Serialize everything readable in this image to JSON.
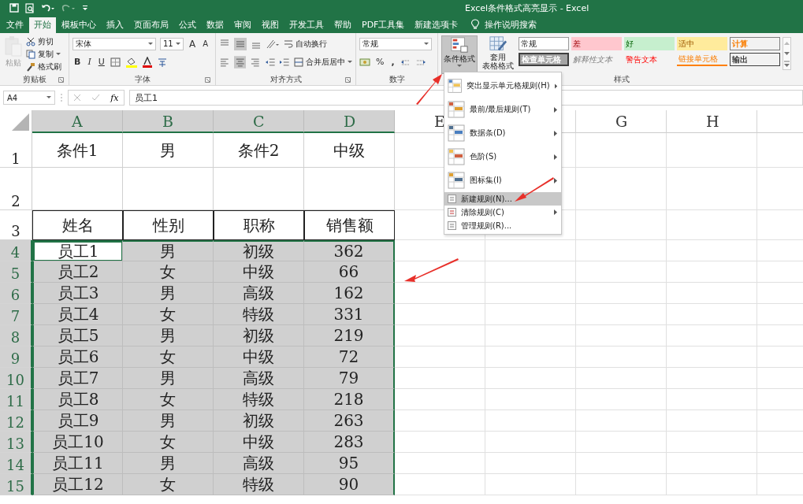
{
  "title_bar": {
    "title": "Excel条件格式高亮显示  -  Excel"
  },
  "tabs": [
    {
      "label": "文件",
      "selected": false
    },
    {
      "label": "开始",
      "selected": true
    },
    {
      "label": "模板中心",
      "selected": false
    },
    {
      "label": "插入",
      "selected": false
    },
    {
      "label": "页面布局",
      "selected": false
    },
    {
      "label": "公式",
      "selected": false
    },
    {
      "label": "数据",
      "selected": false
    },
    {
      "label": "审阅",
      "selected": false
    },
    {
      "label": "视图",
      "selected": false
    },
    {
      "label": "开发工具",
      "selected": false
    },
    {
      "label": "帮助",
      "selected": false
    },
    {
      "label": "PDF工具集",
      "selected": false
    },
    {
      "label": "新建选项卡",
      "selected": false
    }
  ],
  "tell_me": "操作说明搜索",
  "clipboard": {
    "paste": {
      "label": "粘贴",
      "disabled": true
    },
    "items": [
      {
        "label": "剪切",
        "caret": false
      },
      {
        "label": "复制",
        "caret": true
      },
      {
        "label": "格式刷",
        "caret": false
      }
    ],
    "group_label": "剪贴板"
  },
  "font": {
    "name": "宋体",
    "size": "11",
    "grow": "A",
    "shrink": "A",
    "bold": "B",
    "italic": "I",
    "underline": "U",
    "group_label": "字体"
  },
  "alignment": {
    "wrap": "自动换行",
    "merge": "合并后居中",
    "group_label": "对齐方式"
  },
  "number": {
    "format": "常规",
    "percent": "%",
    "comma": ",",
    "group_label": "数字"
  },
  "styles": {
    "conditional": {
      "label": "条件格式",
      "selected": true
    },
    "table_lines": [
      "套用",
      "表格格式"
    ],
    "cells": [
      {
        "label": "常规",
        "kind": "normal"
      },
      {
        "label": "差",
        "kind": "bad"
      },
      {
        "label": "好",
        "kind": "good"
      },
      {
        "label": "适中",
        "kind": "neutral"
      },
      {
        "label": "计算",
        "kind": "calculation"
      },
      {
        "label": "检查单元格",
        "kind": "check"
      },
      {
        "label": "解释性文本",
        "kind": "explanatory"
      },
      {
        "label": "警告文本",
        "kind": "warning"
      },
      {
        "label": "链接单元格",
        "kind": "linked"
      },
      {
        "label": "输出",
        "kind": "output"
      }
    ],
    "group_label": "样式"
  },
  "formula_bar": {
    "name_box": "A4",
    "fx": "fx",
    "value": "员工1"
  },
  "sheet": {
    "columns": [
      {
        "label": "A",
        "selected": true
      },
      {
        "label": "B",
        "selected": true
      },
      {
        "label": "C",
        "selected": true
      },
      {
        "label": "D",
        "selected": true
      },
      {
        "label": "E",
        "selected": false
      },
      {
        "selected": false
      },
      {
        "label": "G",
        "selected": false
      },
      {
        "label": "H",
        "selected": false
      }
    ],
    "rows": [
      {
        "number": "1",
        "kind": "plain",
        "selected": false,
        "cells": [
          {
            "text": "条件1",
            "active": false
          },
          {
            "text": "男",
            "active": false
          },
          {
            "text": "条件2",
            "active": false
          },
          {
            "text": "中级",
            "active": false
          }
        ]
      },
      {
        "number": "2",
        "kind": "plain",
        "selected": false,
        "cells": []
      },
      {
        "number": "3",
        "kind": "header",
        "selected": false,
        "cells": [
          {
            "text": "姓名",
            "active": false
          },
          {
            "text": "性别",
            "active": false
          },
          {
            "text": "职称",
            "active": false
          },
          {
            "text": "销售额",
            "active": false
          }
        ]
      },
      {
        "number": "4",
        "kind": "plain",
        "selected": true,
        "cells": [
          {
            "text": "员工1",
            "active": true
          },
          {
            "text": "男",
            "active": false
          },
          {
            "text": "初级",
            "active": false
          },
          {
            "text": "362",
            "active": false
          }
        ]
      },
      {
        "number": "5",
        "kind": "plain",
        "selected": true,
        "cells": [
          {
            "text": "员工2",
            "active": false
          },
          {
            "text": "女",
            "active": false
          },
          {
            "text": "中级",
            "active": false
          },
          {
            "text": "66",
            "active": false
          }
        ]
      },
      {
        "number": "6",
        "kind": "plain",
        "selected": true,
        "cells": [
          {
            "text": "员工3",
            "active": false
          },
          {
            "text": "男",
            "active": false
          },
          {
            "text": "高级",
            "active": false
          },
          {
            "text": "162",
            "active": false
          }
        ]
      },
      {
        "number": "7",
        "kind": "plain",
        "selected": true,
        "cells": [
          {
            "text": "员工4",
            "active": false
          },
          {
            "text": "女",
            "active": false
          },
          {
            "text": "特级",
            "active": false
          },
          {
            "text": "331",
            "active": false
          }
        ]
      },
      {
        "number": "8",
        "kind": "plain",
        "selected": true,
        "cells": [
          {
            "text": "员工5",
            "active": false
          },
          {
            "text": "男",
            "active": false
          },
          {
            "text": "初级",
            "active": false
          },
          {
            "text": "219",
            "active": false
          }
        ]
      },
      {
        "number": "9",
        "kind": "plain",
        "selected": true,
        "cells": [
          {
            "text": "员工6",
            "active": false
          },
          {
            "text": "女",
            "active": false
          },
          {
            "text": "中级",
            "active": false
          },
          {
            "text": "72",
            "active": false
          }
        ]
      },
      {
        "number": "10",
        "kind": "plain",
        "selected": true,
        "cells": [
          {
            "text": "员工7",
            "active": false
          },
          {
            "text": "男",
            "active": false
          },
          {
            "text": "高级",
            "active": false
          },
          {
            "text": "79",
            "active": false
          }
        ]
      },
      {
        "number": "11",
        "kind": "plain",
        "selected": true,
        "cells": [
          {
            "text": "员工8",
            "active": false
          },
          {
            "text": "女",
            "active": false
          },
          {
            "text": "特级",
            "active": false
          },
          {
            "text": "218",
            "active": false
          }
        ]
      },
      {
        "number": "12",
        "kind": "plain",
        "selected": true,
        "cells": [
          {
            "text": "员工9",
            "active": false
          },
          {
            "text": "男",
            "active": false
          },
          {
            "text": "初级",
            "active": false
          },
          {
            "text": "263",
            "active": false
          }
        ]
      },
      {
        "number": "13",
        "kind": "plain",
        "selected": true,
        "cells": [
          {
            "text": "员工10",
            "active": false
          },
          {
            "text": "女",
            "active": false
          },
          {
            "text": "中级",
            "active": false
          },
          {
            "text": "283",
            "active": false
          }
        ]
      },
      {
        "number": "14",
        "kind": "plain",
        "selected": true,
        "cells": [
          {
            "text": "员工11",
            "active": false
          },
          {
            "text": "男",
            "active": false
          },
          {
            "text": "高级",
            "active": false
          },
          {
            "text": "95",
            "active": false
          }
        ]
      },
      {
        "number": "15",
        "kind": "plain",
        "selected": true,
        "cells": [
          {
            "text": "员工12",
            "active": false
          },
          {
            "text": "女",
            "active": false
          },
          {
            "text": "特级",
            "active": false
          },
          {
            "text": "90",
            "active": false
          }
        ]
      }
    ]
  },
  "menu": {
    "items": [
      {
        "label": "突出显示单元格规则(H)",
        "kind": "large",
        "submenu": true,
        "selected": false
      },
      {
        "label": "最前/最后规则(T)",
        "kind": "large",
        "submenu": true,
        "selected": false
      },
      {
        "label": "数据条(D)",
        "kind": "large",
        "submenu": true,
        "selected": false
      },
      {
        "label": "色阶(S)",
        "kind": "large",
        "submenu": true,
        "selected": false
      },
      {
        "label": "图标集(I)",
        "kind": "large",
        "submenu": true,
        "selected": false
      },
      {
        "label": "新建规则(N)...",
        "kind": "small",
        "submenu": false,
        "selected": true
      },
      {
        "label": "清除规则(C)",
        "kind": "small",
        "submenu": true,
        "selected": false
      },
      {
        "label": "管理规则(R)...",
        "kind": "small",
        "submenu": false,
        "selected": false
      }
    ]
  }
}
